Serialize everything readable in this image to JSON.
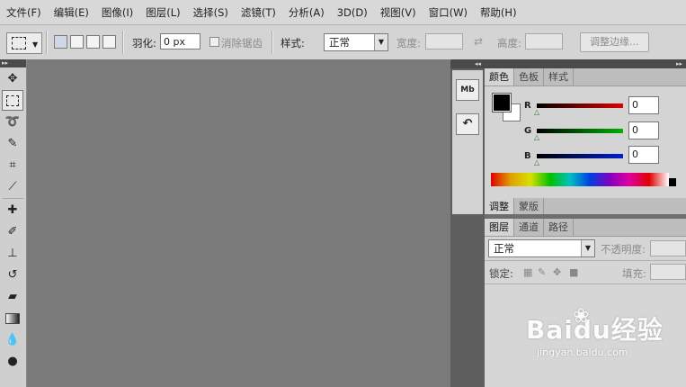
{
  "menubar": {
    "items": [
      "文件(F)",
      "编辑(E)",
      "图像(I)",
      "图层(L)",
      "选择(S)",
      "滤镜(T)",
      "分析(A)",
      "3D(D)",
      "视图(V)",
      "窗口(W)",
      "帮助(H)"
    ]
  },
  "options": {
    "feather_label": "羽化:",
    "feather_value": "0 px",
    "antialias_label": "消除锯齿",
    "style_label": "样式:",
    "style_value": "正常",
    "width_label": "宽度:",
    "swap_symbol": "⇄",
    "height_label": "高度:",
    "refine_edge_label": "调整边缘..."
  },
  "tools": [
    "move-tool",
    "rect-marquee-tool",
    "lasso-tool",
    "quick-select-tool",
    "crop-tool",
    "eyedropper-tool",
    "spot-heal-tool",
    "brush-tool",
    "clone-stamp-tool",
    "history-brush-tool",
    "eraser-tool",
    "gradient-tool",
    "blur-tool",
    "dodge-tool"
  ],
  "dock": {
    "mini_bridge_label": "Mb"
  },
  "color_panel": {
    "tabs": [
      "颜色",
      "色板",
      "样式"
    ],
    "active_tab": "颜色",
    "channels": [
      {
        "label": "R",
        "value": "0",
        "gradient": "#e00000"
      },
      {
        "label": "G",
        "value": "0",
        "gradient": "#00b000"
      },
      {
        "label": "B",
        "value": "0",
        "gradient": "#0020d0"
      }
    ],
    "foreground": "#000000",
    "background": "#ffffff"
  },
  "adjust_panel": {
    "tabs": [
      "调整",
      "蒙版"
    ],
    "active_tab": "调整"
  },
  "layers_panel": {
    "tabs": [
      "图层",
      "通道",
      "路径"
    ],
    "active_tab": "图层",
    "blend_mode": "正常",
    "opacity_label": "不透明度:",
    "lock_label": "锁定:",
    "fill_label": "填充:"
  },
  "watermark": {
    "main": "Baidu经验",
    "sub": "jingyan.baidu.com"
  }
}
